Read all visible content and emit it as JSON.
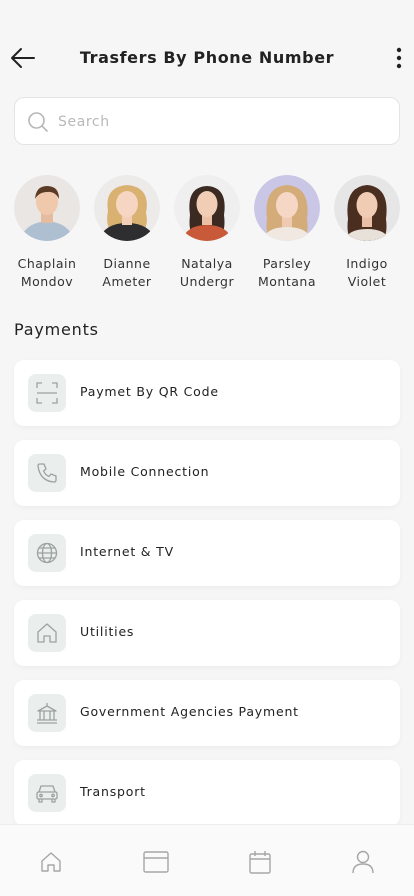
{
  "header": {
    "title": "Trasfers By Phone Number"
  },
  "search": {
    "placeholder": "Search"
  },
  "contacts": [
    {
      "first": "Chaplain",
      "last": "Mondov"
    },
    {
      "first": "Dianne",
      "last": "Ameter"
    },
    {
      "first": "Natalya",
      "last": "Undergr"
    },
    {
      "first": "Parsley",
      "last": "Montana"
    },
    {
      "first": "Indigo",
      "last": "Violet"
    }
  ],
  "payments": {
    "title": "Payments",
    "items": [
      {
        "label": "Paymet By QR Code",
        "icon": "qr-scan-icon"
      },
      {
        "label": "Mobile Connection",
        "icon": "phone-icon"
      },
      {
        "label": "Internet & TV",
        "icon": "globe-icon"
      },
      {
        "label": "Utilities",
        "icon": "house-icon"
      },
      {
        "label": "Government Agencies Payment",
        "icon": "government-building-icon"
      },
      {
        "label": "Transport",
        "icon": "car-icon"
      }
    ]
  },
  "tabbar": {
    "items": [
      "home-icon",
      "card-icon",
      "calendar-icon",
      "profile-icon"
    ]
  },
  "colors": {
    "icon_bg": "#eaeeec",
    "icon_stroke": "#9aa39e",
    "background": "#f6f6f6"
  }
}
